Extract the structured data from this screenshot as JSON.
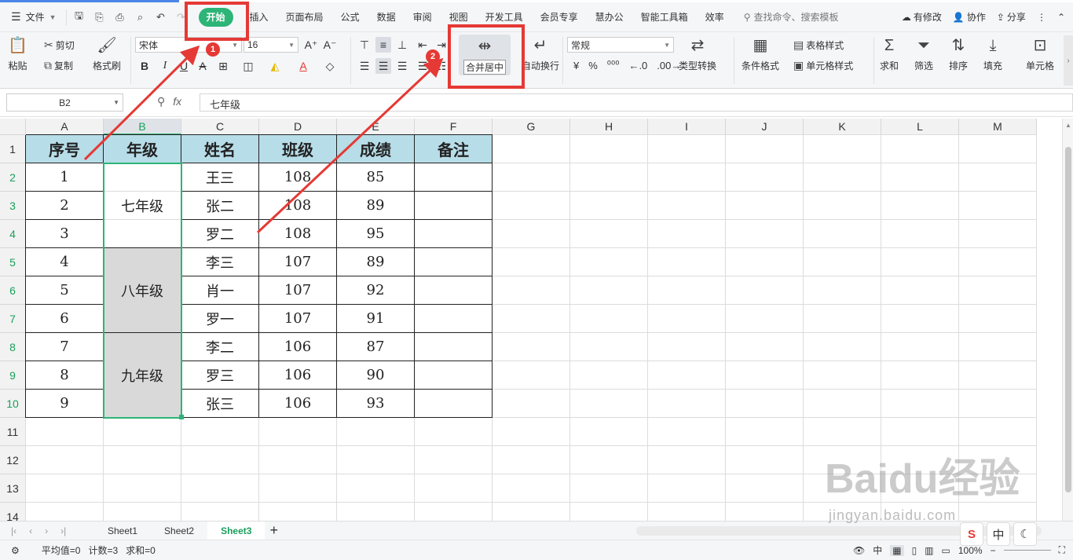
{
  "menu": {
    "file_label": "文件",
    "tabs": [
      "开始",
      "插入",
      "页面布局",
      "公式",
      "数据",
      "审阅",
      "视图",
      "开发工具",
      "会员专享",
      "慧办公",
      "智能工具箱",
      "效率"
    ],
    "search_placeholder": "查找命令、搜索模板",
    "right": [
      "有修改",
      "协作",
      "分享"
    ]
  },
  "ribbon": {
    "paste": "粘贴",
    "cut": "剪切",
    "copy": "复制",
    "format_painter": "格式刷",
    "font_name": "宋体",
    "font_size": "16",
    "merge_center": "合并居中",
    "wrap_text": "自动换行",
    "number_format": "常规",
    "type_convert": "类型转换",
    "cond_format": "条件格式",
    "table_style": "表格样式",
    "cell_style": "单元格样式",
    "sum": "求和",
    "filter": "筛选",
    "sort": "排序",
    "fill": "填充",
    "cell": "单元格"
  },
  "formula_bar": {
    "name_box": "B2",
    "fx": "fx",
    "value": "七年级"
  },
  "columns": [
    "A",
    "B",
    "C",
    "D",
    "E",
    "F",
    "G",
    "H",
    "I",
    "J",
    "K",
    "L",
    "M"
  ],
  "rows": [
    "1",
    "2",
    "3",
    "4",
    "5",
    "6",
    "7",
    "8",
    "9",
    "10",
    "11",
    "12",
    "13",
    "14"
  ],
  "table": {
    "headers": [
      "序号",
      "年级",
      "姓名",
      "班级",
      "成绩",
      "备注"
    ],
    "seq": [
      "1",
      "2",
      "3",
      "4",
      "5",
      "6",
      "7",
      "8",
      "9"
    ],
    "grades": [
      "七年级",
      "八年级",
      "九年级"
    ],
    "names": [
      "王三",
      "张二",
      "罗二",
      "李三",
      "肖一",
      "罗一",
      "李二",
      "罗三",
      "张三"
    ],
    "classes": [
      "108",
      "108",
      "108",
      "107",
      "107",
      "107",
      "106",
      "106",
      "106"
    ],
    "scores": [
      "85",
      "89",
      "95",
      "89",
      "92",
      "91",
      "87",
      "90",
      "93"
    ]
  },
  "sheets": [
    "Sheet1",
    "Sheet2",
    "Sheet3"
  ],
  "active_sheet": "Sheet3",
  "status": {
    "avg": "平均值=0",
    "count": "计数=3",
    "sum": "求和=0",
    "zoom": "100%",
    "ime_mode": "中"
  },
  "annotations": {
    "badge1": "1",
    "badge2": "2"
  },
  "watermark": {
    "main": "Baidu经验",
    "sub": "jingyan.baidu.com"
  },
  "colors": {
    "accent": "#2db477",
    "header_fill": "#b7dde8",
    "merged_fill": "#d9d9d9",
    "annotation": "#e53935"
  }
}
